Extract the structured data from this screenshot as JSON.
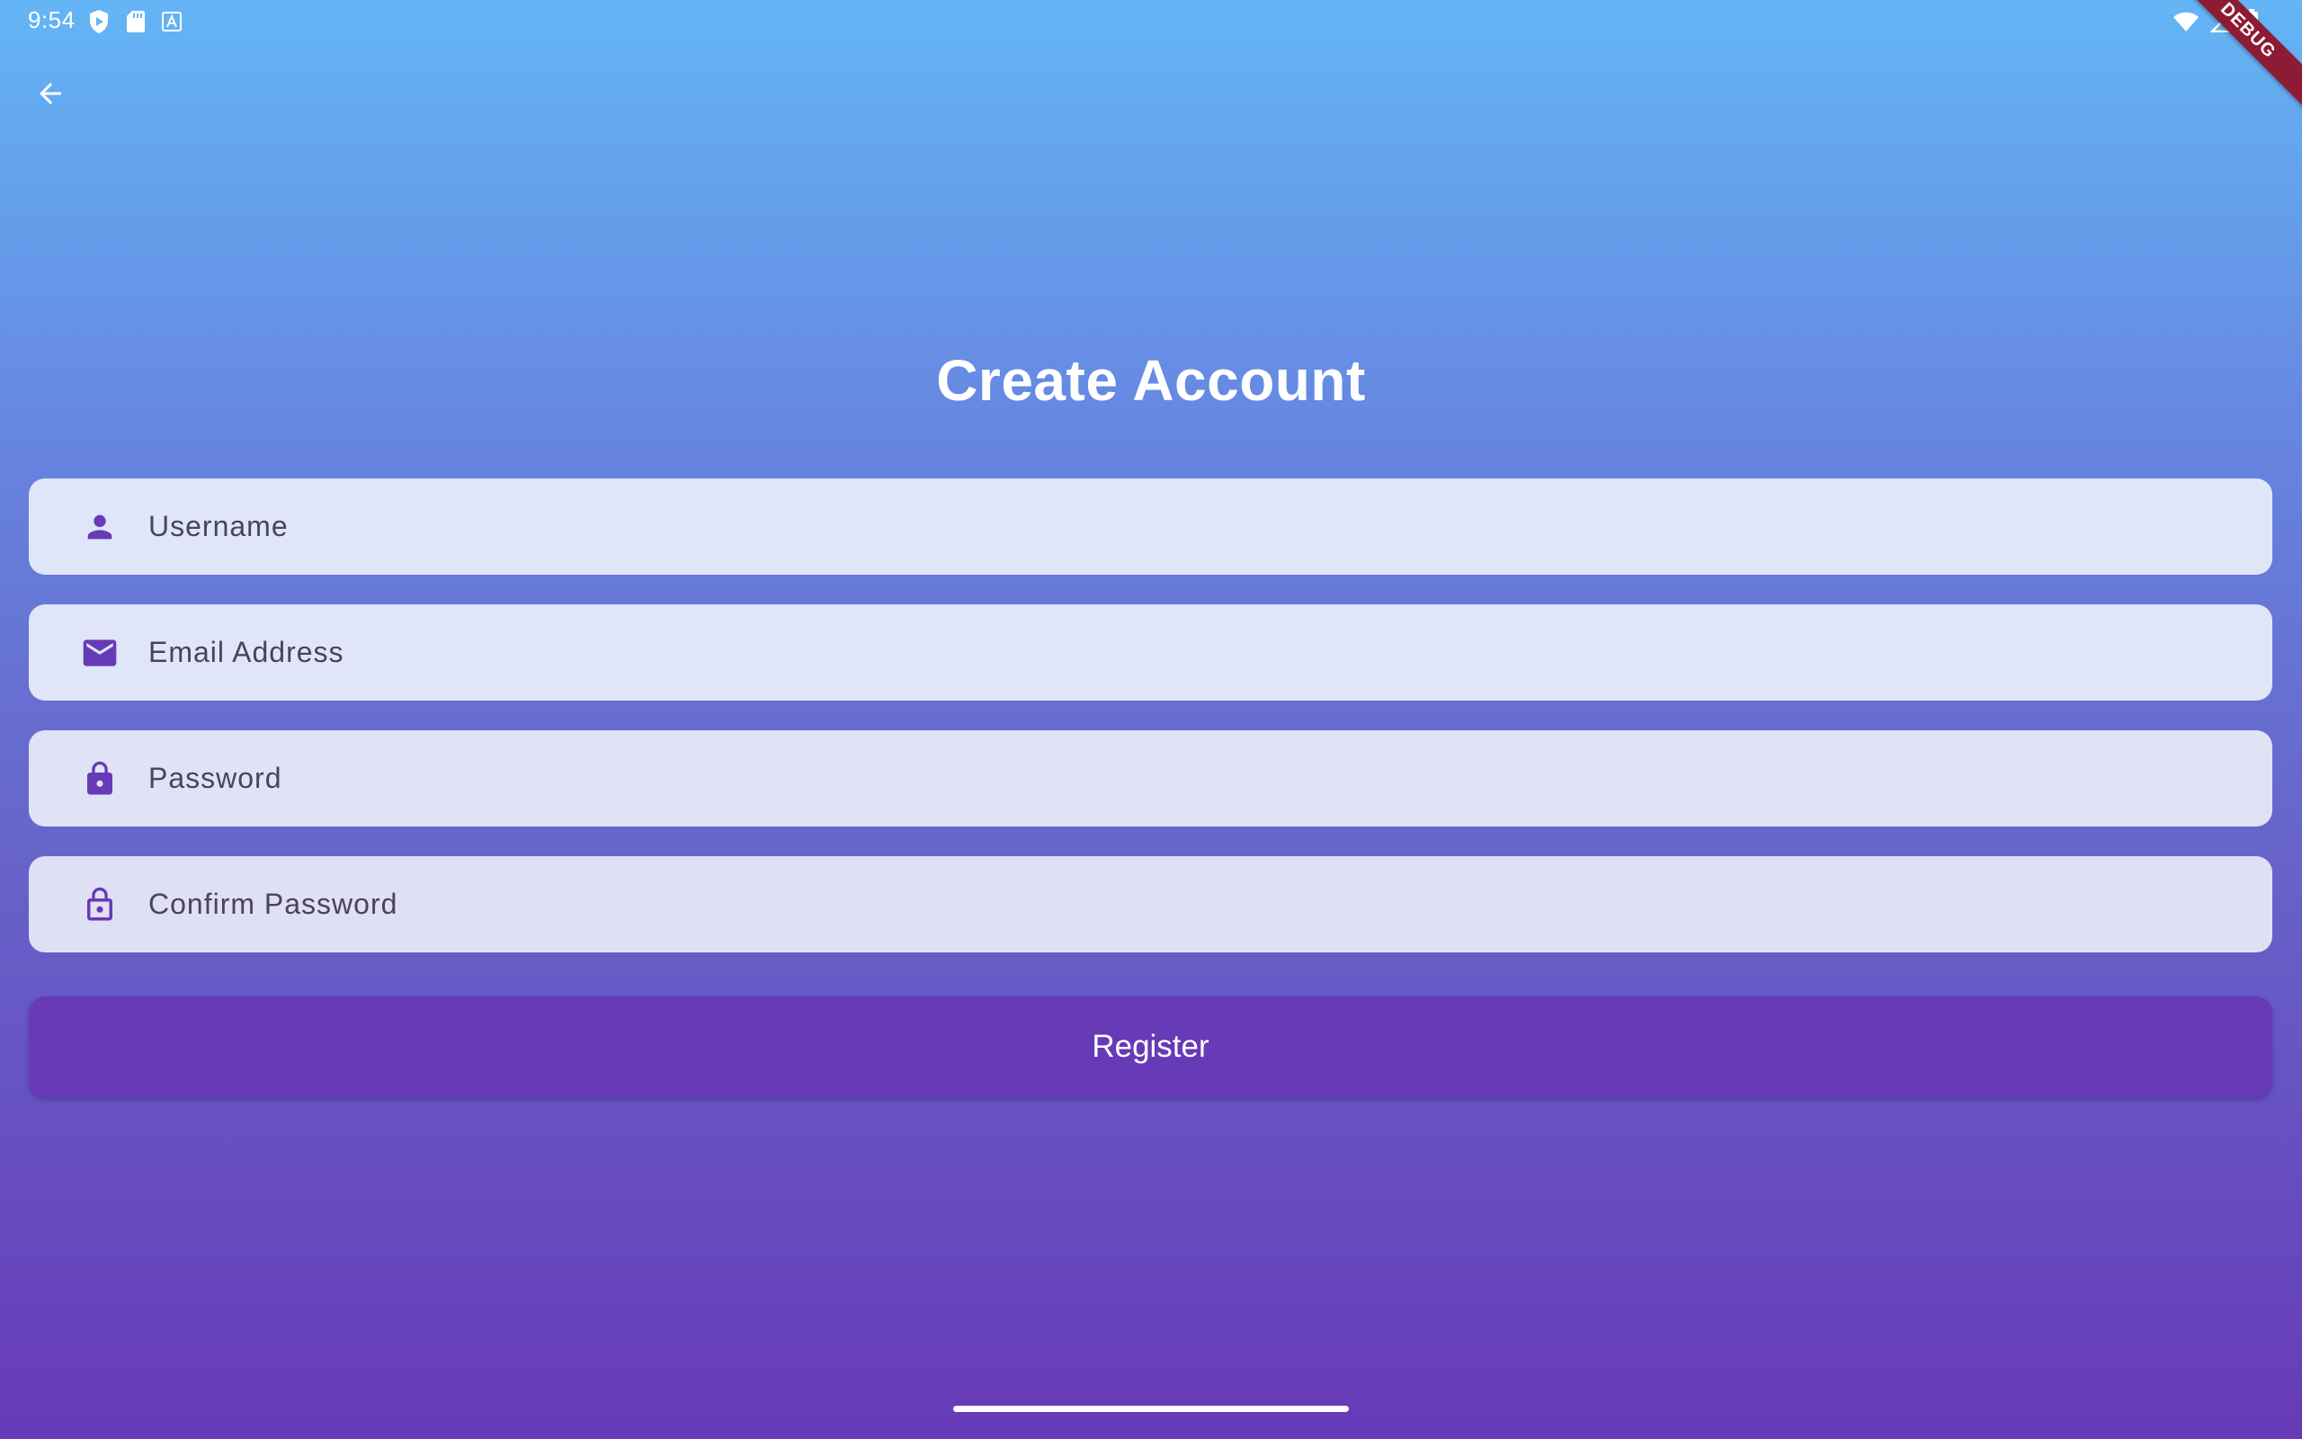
{
  "status_bar": {
    "time": "9:54",
    "left_icons": [
      "shield-play-icon",
      "sd-card-icon",
      "font-a-icon"
    ],
    "right_icons": [
      "wifi-icon",
      "cellular-signal-icon",
      "battery-icon"
    ]
  },
  "debug_banner": {
    "label": "DEBUG"
  },
  "app_bar": {
    "back_icon": "arrow-back-icon"
  },
  "page": {
    "title": "Create Account"
  },
  "form": {
    "fields": [
      {
        "label": "Username",
        "icon": "person-icon"
      },
      {
        "label": "Email Address",
        "icon": "email-icon"
      },
      {
        "label": "Password",
        "icon": "lock-icon"
      },
      {
        "label": "Confirm Password",
        "icon": "lock-outline-icon"
      }
    ],
    "submit_label": "Register"
  },
  "colors": {
    "gradient_top": "#64b5f6",
    "gradient_bottom": "#673ab7",
    "accent": "#673ab7",
    "field_background": "#e0e4f7",
    "debug_ribbon": "#8e1b34"
  }
}
